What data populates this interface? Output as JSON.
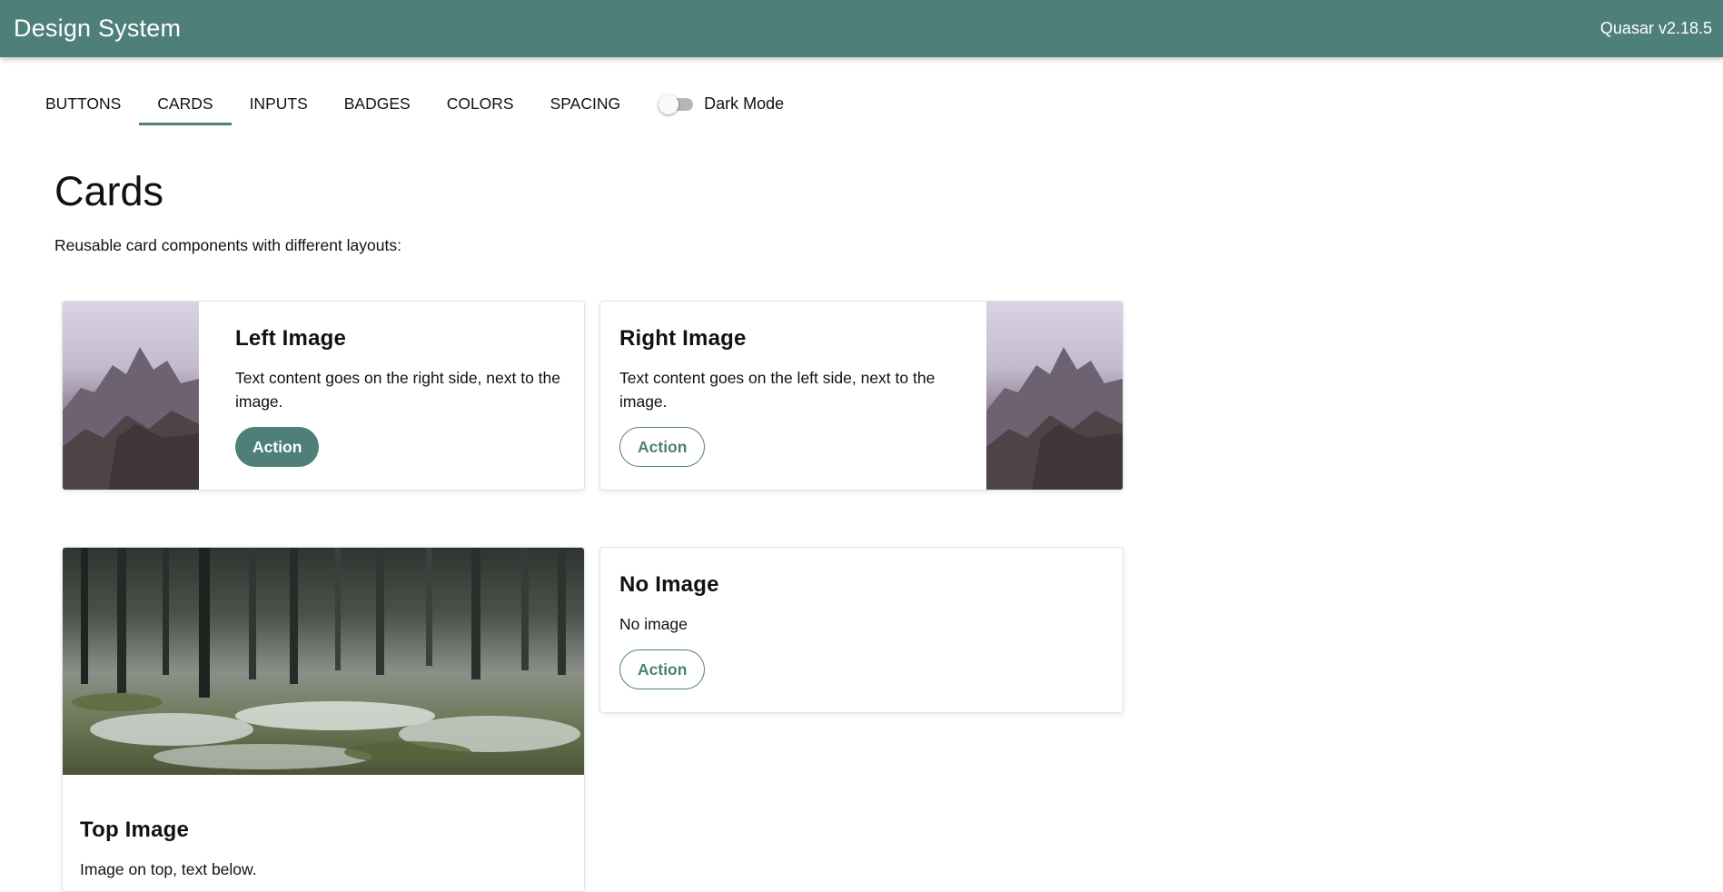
{
  "header": {
    "title": "Design System",
    "version": "Quasar v2.18.5"
  },
  "tabs": [
    {
      "label": "BUTTONS",
      "active": false
    },
    {
      "label": "CARDS",
      "active": true
    },
    {
      "label": "INPUTS",
      "active": false
    },
    {
      "label": "BADGES",
      "active": false
    },
    {
      "label": "COLORS",
      "active": false
    },
    {
      "label": "SPACING",
      "active": false
    }
  ],
  "dark_mode": {
    "label": "Dark Mode",
    "enabled": false
  },
  "main": {
    "title": "Cards",
    "subtitle": "Reusable card components with different layouts:"
  },
  "cards": {
    "left_image": {
      "title": "Left Image",
      "text": "Text content goes on the right side, next to the image.",
      "action": "Action"
    },
    "right_image": {
      "title": "Right Image",
      "text": "Text content goes on the left side, next to the image.",
      "action": "Action"
    },
    "top_image": {
      "title": "Top Image",
      "text": "Image on top, text below."
    },
    "no_image": {
      "title": "No Image",
      "text": "No image",
      "action": "Action"
    }
  },
  "colors": {
    "primary": "#4e7f79",
    "background": "#ffffff",
    "text": "#111111"
  }
}
